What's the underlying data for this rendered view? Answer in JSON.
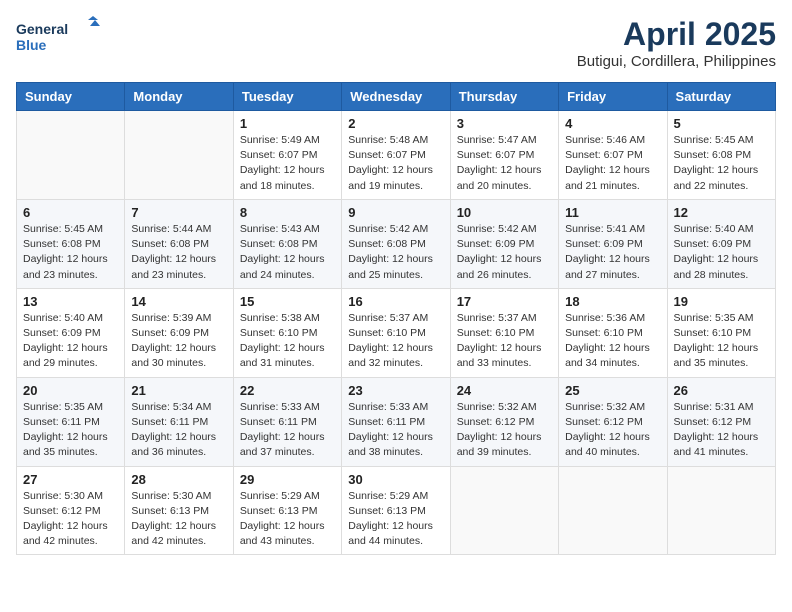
{
  "logo": {
    "line1": "General",
    "line2": "Blue"
  },
  "title": "April 2025",
  "subtitle": "Butigui, Cordillera, Philippines",
  "weekdays": [
    "Sunday",
    "Monday",
    "Tuesday",
    "Wednesday",
    "Thursday",
    "Friday",
    "Saturday"
  ],
  "weeks": [
    [
      {
        "day": "",
        "sunrise": "",
        "sunset": "",
        "daylight": ""
      },
      {
        "day": "",
        "sunrise": "",
        "sunset": "",
        "daylight": ""
      },
      {
        "day": "1",
        "sunrise": "Sunrise: 5:49 AM",
        "sunset": "Sunset: 6:07 PM",
        "daylight": "Daylight: 12 hours and 18 minutes."
      },
      {
        "day": "2",
        "sunrise": "Sunrise: 5:48 AM",
        "sunset": "Sunset: 6:07 PM",
        "daylight": "Daylight: 12 hours and 19 minutes."
      },
      {
        "day": "3",
        "sunrise": "Sunrise: 5:47 AM",
        "sunset": "Sunset: 6:07 PM",
        "daylight": "Daylight: 12 hours and 20 minutes."
      },
      {
        "day": "4",
        "sunrise": "Sunrise: 5:46 AM",
        "sunset": "Sunset: 6:07 PM",
        "daylight": "Daylight: 12 hours and 21 minutes."
      },
      {
        "day": "5",
        "sunrise": "Sunrise: 5:45 AM",
        "sunset": "Sunset: 6:08 PM",
        "daylight": "Daylight: 12 hours and 22 minutes."
      }
    ],
    [
      {
        "day": "6",
        "sunrise": "Sunrise: 5:45 AM",
        "sunset": "Sunset: 6:08 PM",
        "daylight": "Daylight: 12 hours and 23 minutes."
      },
      {
        "day": "7",
        "sunrise": "Sunrise: 5:44 AM",
        "sunset": "Sunset: 6:08 PM",
        "daylight": "Daylight: 12 hours and 23 minutes."
      },
      {
        "day": "8",
        "sunrise": "Sunrise: 5:43 AM",
        "sunset": "Sunset: 6:08 PM",
        "daylight": "Daylight: 12 hours and 24 minutes."
      },
      {
        "day": "9",
        "sunrise": "Sunrise: 5:42 AM",
        "sunset": "Sunset: 6:08 PM",
        "daylight": "Daylight: 12 hours and 25 minutes."
      },
      {
        "day": "10",
        "sunrise": "Sunrise: 5:42 AM",
        "sunset": "Sunset: 6:09 PM",
        "daylight": "Daylight: 12 hours and 26 minutes."
      },
      {
        "day": "11",
        "sunrise": "Sunrise: 5:41 AM",
        "sunset": "Sunset: 6:09 PM",
        "daylight": "Daylight: 12 hours and 27 minutes."
      },
      {
        "day": "12",
        "sunrise": "Sunrise: 5:40 AM",
        "sunset": "Sunset: 6:09 PM",
        "daylight": "Daylight: 12 hours and 28 minutes."
      }
    ],
    [
      {
        "day": "13",
        "sunrise": "Sunrise: 5:40 AM",
        "sunset": "Sunset: 6:09 PM",
        "daylight": "Daylight: 12 hours and 29 minutes."
      },
      {
        "day": "14",
        "sunrise": "Sunrise: 5:39 AM",
        "sunset": "Sunset: 6:09 PM",
        "daylight": "Daylight: 12 hours and 30 minutes."
      },
      {
        "day": "15",
        "sunrise": "Sunrise: 5:38 AM",
        "sunset": "Sunset: 6:10 PM",
        "daylight": "Daylight: 12 hours and 31 minutes."
      },
      {
        "day": "16",
        "sunrise": "Sunrise: 5:37 AM",
        "sunset": "Sunset: 6:10 PM",
        "daylight": "Daylight: 12 hours and 32 minutes."
      },
      {
        "day": "17",
        "sunrise": "Sunrise: 5:37 AM",
        "sunset": "Sunset: 6:10 PM",
        "daylight": "Daylight: 12 hours and 33 minutes."
      },
      {
        "day": "18",
        "sunrise": "Sunrise: 5:36 AM",
        "sunset": "Sunset: 6:10 PM",
        "daylight": "Daylight: 12 hours and 34 minutes."
      },
      {
        "day": "19",
        "sunrise": "Sunrise: 5:35 AM",
        "sunset": "Sunset: 6:10 PM",
        "daylight": "Daylight: 12 hours and 35 minutes."
      }
    ],
    [
      {
        "day": "20",
        "sunrise": "Sunrise: 5:35 AM",
        "sunset": "Sunset: 6:11 PM",
        "daylight": "Daylight: 12 hours and 35 minutes."
      },
      {
        "day": "21",
        "sunrise": "Sunrise: 5:34 AM",
        "sunset": "Sunset: 6:11 PM",
        "daylight": "Daylight: 12 hours and 36 minutes."
      },
      {
        "day": "22",
        "sunrise": "Sunrise: 5:33 AM",
        "sunset": "Sunset: 6:11 PM",
        "daylight": "Daylight: 12 hours and 37 minutes."
      },
      {
        "day": "23",
        "sunrise": "Sunrise: 5:33 AM",
        "sunset": "Sunset: 6:11 PM",
        "daylight": "Daylight: 12 hours and 38 minutes."
      },
      {
        "day": "24",
        "sunrise": "Sunrise: 5:32 AM",
        "sunset": "Sunset: 6:12 PM",
        "daylight": "Daylight: 12 hours and 39 minutes."
      },
      {
        "day": "25",
        "sunrise": "Sunrise: 5:32 AM",
        "sunset": "Sunset: 6:12 PM",
        "daylight": "Daylight: 12 hours and 40 minutes."
      },
      {
        "day": "26",
        "sunrise": "Sunrise: 5:31 AM",
        "sunset": "Sunset: 6:12 PM",
        "daylight": "Daylight: 12 hours and 41 minutes."
      }
    ],
    [
      {
        "day": "27",
        "sunrise": "Sunrise: 5:30 AM",
        "sunset": "Sunset: 6:12 PM",
        "daylight": "Daylight: 12 hours and 42 minutes."
      },
      {
        "day": "28",
        "sunrise": "Sunrise: 5:30 AM",
        "sunset": "Sunset: 6:13 PM",
        "daylight": "Daylight: 12 hours and 42 minutes."
      },
      {
        "day": "29",
        "sunrise": "Sunrise: 5:29 AM",
        "sunset": "Sunset: 6:13 PM",
        "daylight": "Daylight: 12 hours and 43 minutes."
      },
      {
        "day": "30",
        "sunrise": "Sunrise: 5:29 AM",
        "sunset": "Sunset: 6:13 PM",
        "daylight": "Daylight: 12 hours and 44 minutes."
      },
      {
        "day": "",
        "sunrise": "",
        "sunset": "",
        "daylight": ""
      },
      {
        "day": "",
        "sunrise": "",
        "sunset": "",
        "daylight": ""
      },
      {
        "day": "",
        "sunrise": "",
        "sunset": "",
        "daylight": ""
      }
    ]
  ]
}
